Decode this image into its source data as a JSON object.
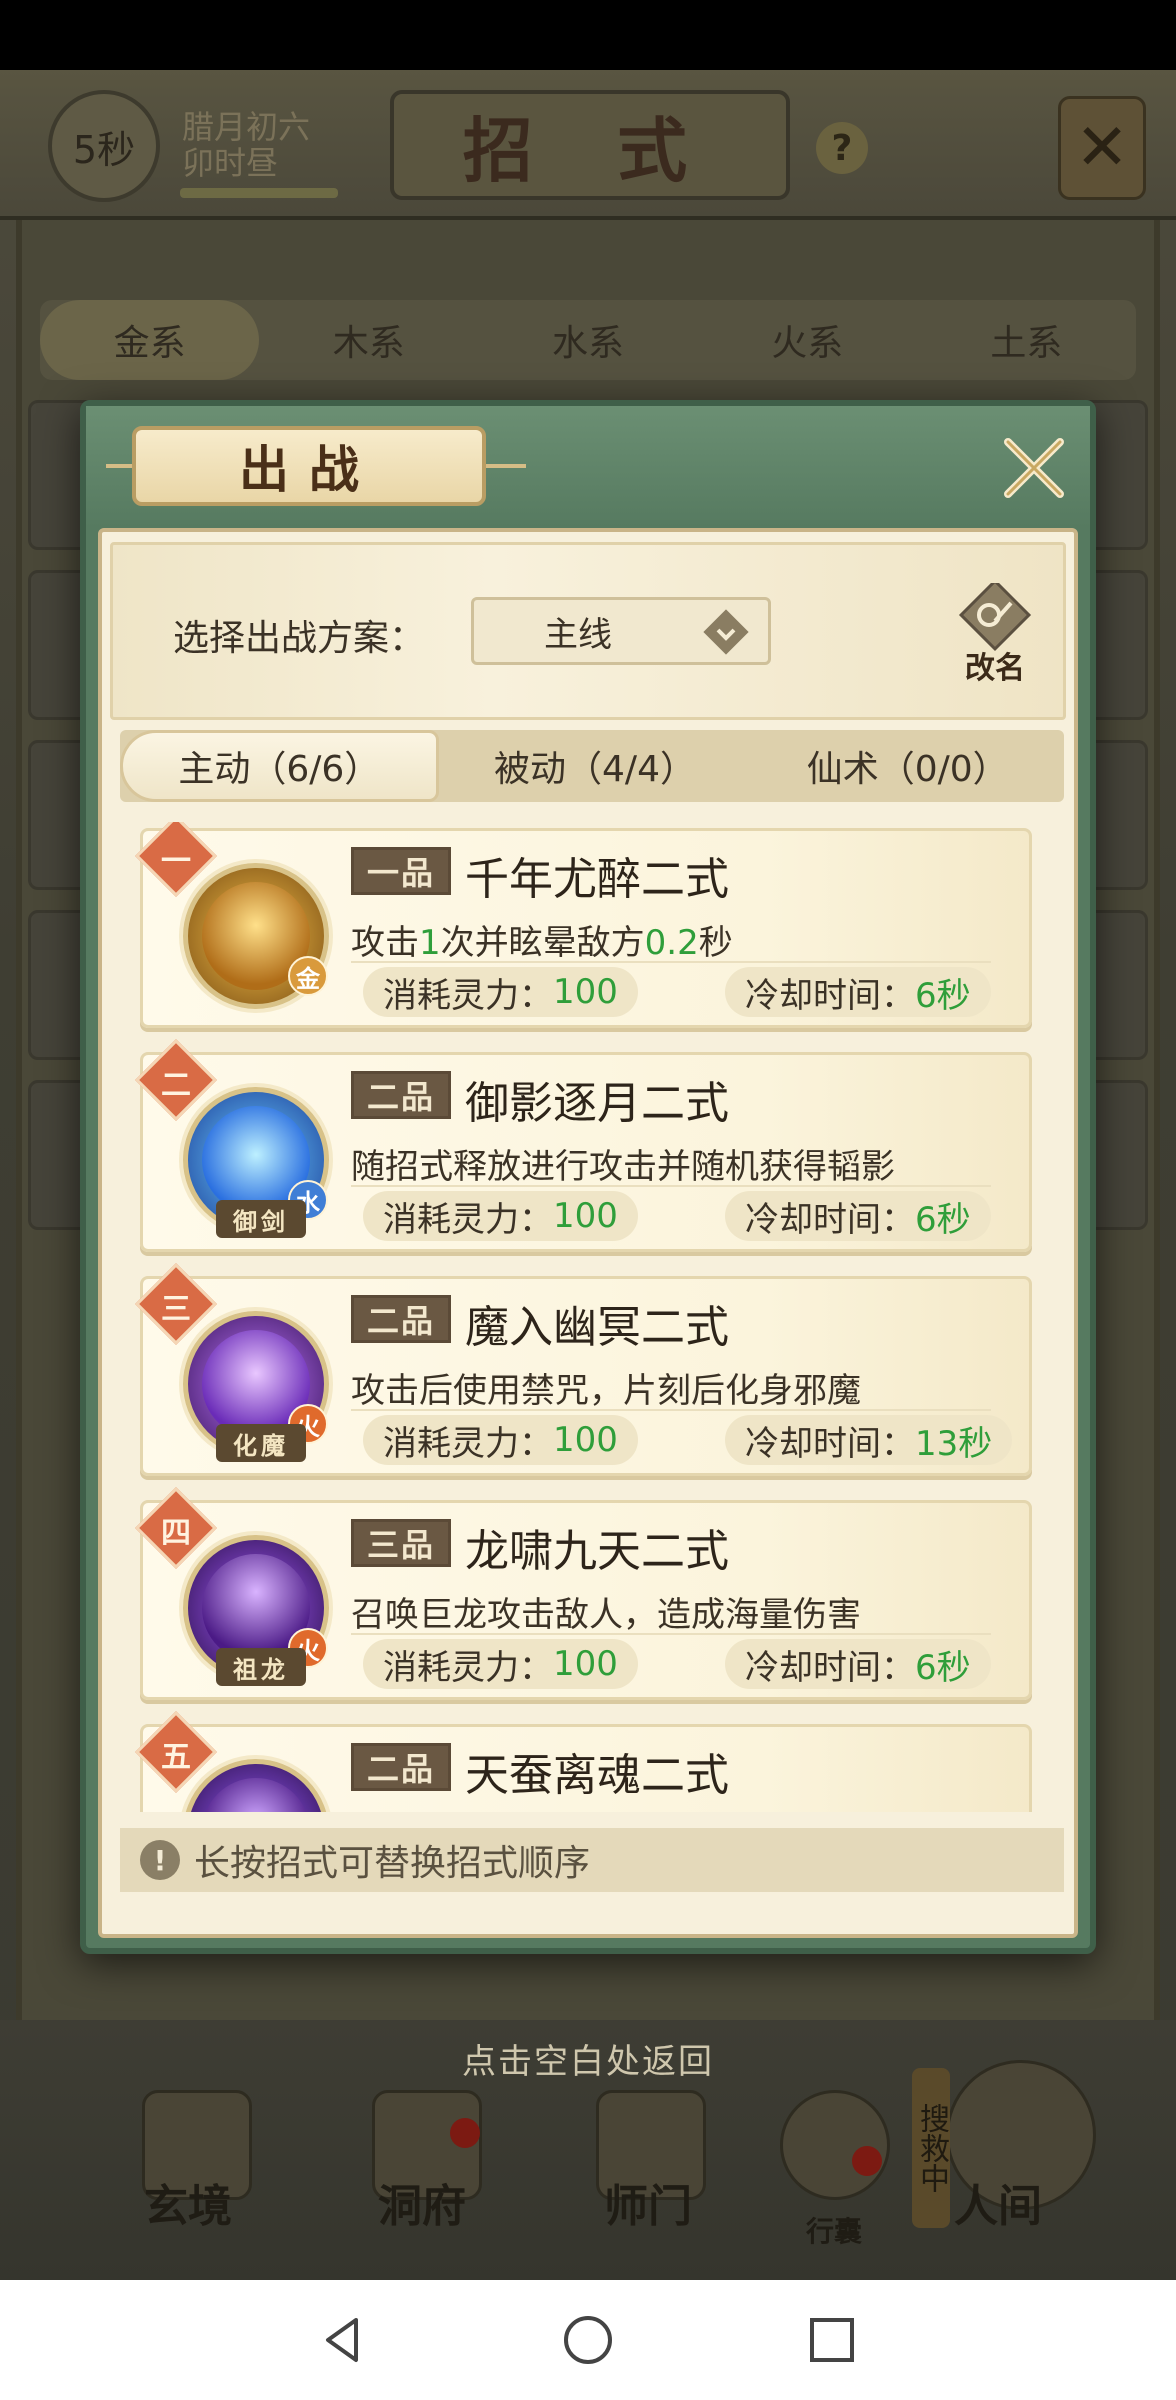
{
  "status": {
    "timer": "5秒",
    "date_line1": "腊月初六",
    "date_line2": "卯时昼"
  },
  "page": {
    "title": "招 式",
    "help": "?",
    "element_tabs": [
      "金系",
      "木系",
      "水系",
      "火系",
      "土系"
    ]
  },
  "dialog": {
    "title": "出战",
    "plan_label": "选择出战方案：",
    "plan_value": "主线",
    "rename_label": "改名",
    "tabs": [
      {
        "label": "主动（6/6）",
        "active": true
      },
      {
        "label": "被动（4/4）",
        "active": false
      },
      {
        "label": "仙术（0/0）",
        "active": false
      }
    ],
    "skills": [
      {
        "rank": "一",
        "grade": "一品",
        "name": "千年尤醉二式",
        "desc_parts": [
          "攻击",
          "1",
          "次并眩晕敌方",
          "0.2",
          "秒"
        ],
        "element": "金",
        "element_color": "#d99a3c",
        "style_tag": "",
        "cost_label": "消耗灵力：",
        "cost": "100",
        "cd_label": "冷却时间：",
        "cd": "6秒",
        "icon_colors": [
          "#f6c24c",
          "#7a4d12"
        ]
      },
      {
        "rank": "二",
        "grade": "二品",
        "name": "御影逐月二式",
        "desc_parts": [
          "随招式释放进行攻击并随机获得韬影",
          "",
          "",
          "",
          ""
        ],
        "element": "水",
        "element_color": "#3f7ed6",
        "style_tag": "御剑",
        "cost_label": "消耗灵力：",
        "cost": "100",
        "cd_label": "冷却时间：",
        "cd": "6秒",
        "icon_colors": [
          "#6fd0ff",
          "#1b3f9a"
        ]
      },
      {
        "rank": "三",
        "grade": "二品",
        "name": "魔入幽冥二式",
        "desc_parts": [
          "攻击后使用禁咒，片刻后化身邪魔",
          "",
          "",
          "",
          ""
        ],
        "element": "火",
        "element_color": "#e06a2c",
        "style_tag": "化魔",
        "cost_label": "消耗灵力：",
        "cost": "100",
        "cd_label": "冷却时间：",
        "cd": "13秒",
        "icon_colors": [
          "#c27bff",
          "#3a145e"
        ]
      },
      {
        "rank": "四",
        "grade": "三品",
        "name": "龙啸九天二式",
        "desc_parts": [
          "召唤巨龙攻击敌人，造成海量伤害",
          "",
          "",
          "",
          ""
        ],
        "element": "火",
        "element_color": "#e06a2c",
        "style_tag": "祖龙",
        "cost_label": "消耗灵力：",
        "cost": "100",
        "cd_label": "冷却时间：",
        "cd": "6秒",
        "icon_colors": [
          "#a65cff",
          "#2a0f4a"
        ]
      },
      {
        "rank": "五",
        "grade": "二品",
        "name": "天蚕离魂二式",
        "desc_parts": [
          "",
          "",
          "",
          "",
          ""
        ],
        "element": "",
        "element_color": "#d99a3c",
        "style_tag": "",
        "cost_label": "",
        "cost": "",
        "cd_label": "",
        "cd": "",
        "icon_colors": [
          "#9b5cff",
          "#2a0f4a"
        ]
      }
    ],
    "hint": "长按招式可替换招式顺序"
  },
  "return_hint": "点击空白处返回",
  "bottom_nav": [
    "玄境",
    "洞府",
    "师门",
    "行囊",
    "人间"
  ],
  "rescue_tag": "搜救中",
  "system_nav": [
    "back-icon",
    "home-icon",
    "recents-icon"
  ]
}
